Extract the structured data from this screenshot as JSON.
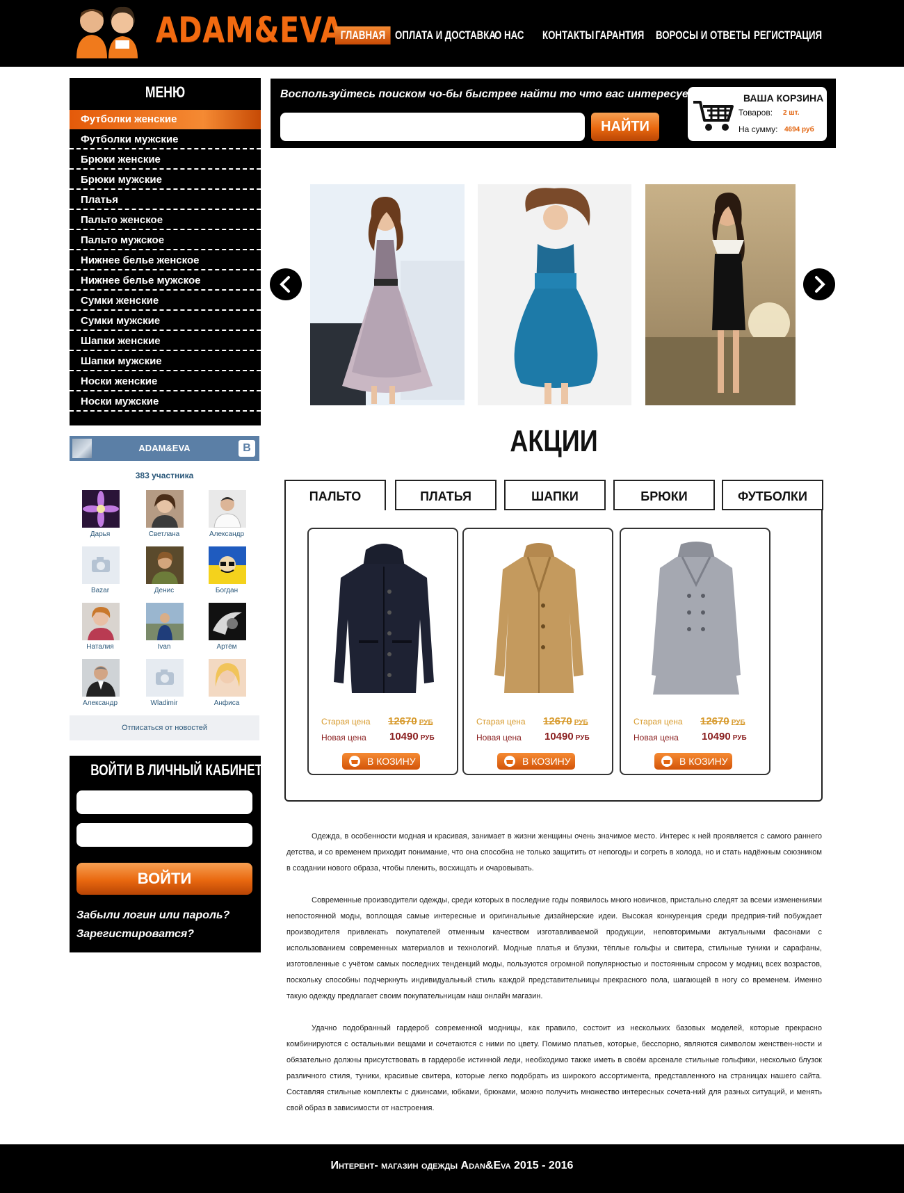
{
  "header": {
    "logo_text": "ADAM&EVA",
    "nav": [
      {
        "label": "ГЛАВНАЯ",
        "active": true
      },
      {
        "label": "ОПЛАТА И ДОСТАВКА",
        "active": false
      },
      {
        "label": "О НАС",
        "active": false
      },
      {
        "label": "КОНТАКТЫ",
        "active": false
      },
      {
        "label": "ГАРАНТИЯ",
        "active": false
      },
      {
        "label": "ВОРОСЫ И ОТВЕТЫ",
        "active": false
      },
      {
        "label": "РЕГИСТРАЦИЯ",
        "active": false
      }
    ]
  },
  "sidebar": {
    "menu_title": "МЕНЮ",
    "items": [
      {
        "label": "Футболки женские",
        "active": true
      },
      {
        "label": "Футболки мужские",
        "active": false
      },
      {
        "label": "Брюки женские",
        "active": false
      },
      {
        "label": "Брюки мужские",
        "active": false
      },
      {
        "label": "Платья",
        "active": false
      },
      {
        "label": "Пальто женское",
        "active": false
      },
      {
        "label": "Пальто мужское",
        "active": false
      },
      {
        "label": "Нижнее белье женское",
        "active": false
      },
      {
        "label": "Нижнее белье мужское",
        "active": false
      },
      {
        "label": "Сумки женские",
        "active": false
      },
      {
        "label": "Сумки мужские",
        "active": false
      },
      {
        "label": "Шапки женские",
        "active": false
      },
      {
        "label": "Шапки мужские",
        "active": false
      },
      {
        "label": "Носки женские",
        "active": false
      },
      {
        "label": "Носки мужские",
        "active": false
      }
    ]
  },
  "vk_widget": {
    "group_name": "ADAM&EVA",
    "vk_badge": "В",
    "members_count": "383 участника",
    "members": [
      {
        "name": "Дарья",
        "avatar": "purple-flower"
      },
      {
        "name": "Светлана",
        "avatar": "woman-portrait"
      },
      {
        "name": "Александр",
        "avatar": "man-portrait"
      },
      {
        "name": "Bazar",
        "avatar": "camera-placeholder"
      },
      {
        "name": "Денис",
        "avatar": "man-portrait"
      },
      {
        "name": "Богдан",
        "avatar": "cartoon-yellow-blue"
      },
      {
        "name": "Наталия",
        "avatar": "woman-portrait"
      },
      {
        "name": "Ivan",
        "avatar": "man-outdoor"
      },
      {
        "name": "Артём",
        "avatar": "dark-art"
      },
      {
        "name": "Александр",
        "avatar": "man-suit"
      },
      {
        "name": "Wladimir",
        "avatar": "camera-placeholder"
      },
      {
        "name": "Анфиса",
        "avatar": "blonde-woman"
      }
    ],
    "unsubscribe": "Отписаться от новостей"
  },
  "login": {
    "title": "ВОЙТИ В ЛИЧНЫЙ КАБИНЕТ",
    "login_value": "",
    "password_value": "",
    "button": "ВОЙТИ",
    "forgot": "Забыли логин или пароль?",
    "register": "Зарегистироватся?"
  },
  "search": {
    "hint": "Воспользуйтесь поиском чо-бы быстрее найти то что вас интересует!",
    "value": "",
    "button": "НАЙТИ"
  },
  "cart": {
    "title": "ВАША КОРЗИНА",
    "items_label": "Товаров:",
    "items_value": "2 шт.",
    "sum_label": "На сумму:",
    "sum_value": "4694 руб"
  },
  "slider": {
    "slides": [
      "dress-lilac",
      "dress-blue",
      "dress-black"
    ]
  },
  "promotions": {
    "title": "АКЦИИ",
    "tabs": [
      {
        "label": "ПАЛЬТО",
        "active": true
      },
      {
        "label": "ПЛАТЬЯ",
        "active": false
      },
      {
        "label": "ШАПКИ",
        "active": false
      },
      {
        "label": "БРЮКИ",
        "active": false
      },
      {
        "label": "ФУТБОЛКИ",
        "active": false
      }
    ],
    "products": [
      {
        "image": "coat-navy",
        "old_label": "Старая цена",
        "old_price": "12670",
        "new_label": "Новая цена",
        "new_price": "10490",
        "currency": "РУБ",
        "button": "В КОЗИНУ"
      },
      {
        "image": "coat-camel",
        "old_label": "Старая цена",
        "old_price": "12670",
        "new_label": "Новая цена",
        "new_price": "10490",
        "currency": "РУБ",
        "button": "В КОЗИНУ"
      },
      {
        "image": "coat-grey",
        "old_label": "Старая цена",
        "old_price": "12670",
        "new_label": "Новая цена",
        "new_price": "10490",
        "currency": "РУБ",
        "button": "В КОЗИНУ"
      }
    ]
  },
  "article": {
    "paragraphs": [
      "Одежда, в особенности модная и красивая, занимает в жизни женщины очень значимое место. Интерес к ней проявляется с самого раннего детства, и со временем приходит понимание, что она способна не только защитить от непогоды и согреть в холода, но и стать надёжным союзником в создании нового образа, чтобы пленить, восхищать и очаровывать.",
      "Современные производители одежды, среди которых в последние годы появилось много новичков, пристально следят за всеми изменениями непостоянной моды, воплощая самые интересные и оригинальные дизайнерские идеи. Высокая конкуренция среди предприя-тий побуждает производителя привлекать покупателей отменным качеством изготавливаемой продукции, неповторимыми актуальными фасонами с использованием современных материалов и технологий. Модные платья и блузки, тёплые гольфы и свитера, стильные туники и сарафаны, изготовленные с учётом самых последних тенденций моды, пользуются огромной популярностью и постоянным спросом у модниц всех возрастов, поскольку способны подчеркнуть индивидуальный стиль каждой представительницы прекрасного пола, шагающей в ногу со временем. Именно такую одежду предлагает своим покупательницам наш онлайн магазин.",
      "Удачно подобранный гардероб современной модницы, как правило, состоит из нескольких базовых моделей, которые прекрасно комбинируются с остальными вещами и сочетаются с ними по цвету. Помимо платьев, которые, бесспорно, являются символом женствен-ности и обязательно должны присутствовать в гардеробе истинной леди, необходимо также иметь в своём арсенале стильные гольфики, несколько блузок различного стиля, туники, красивые свитера, которые легко подобрать из широкого ассортимента, представленного на страницах нашего сайта. Составляя стильные комплекты с джинсами, юбками, брюками, можно получить множество интересных сочета-ний для разных ситуаций, и менять свой образ в зависимости от настроения."
    ]
  },
  "footer": {
    "text": "Интерент- магазин одежды Adan&Eva 2015 - 2016"
  },
  "colors": {
    "accent": "#e9680f",
    "header_bg": "#000000",
    "vk_blue": "#5b7fa6"
  }
}
